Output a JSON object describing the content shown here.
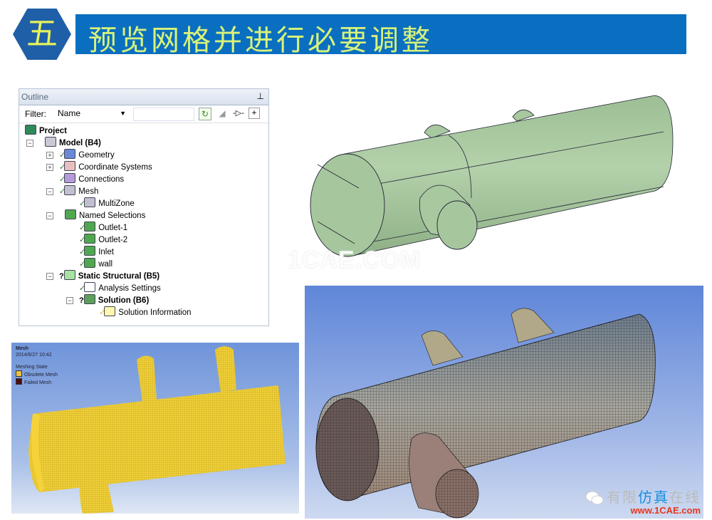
{
  "slide": {
    "number_glyph": "五",
    "title": "预览网格并进行必要调整",
    "colors": {
      "hex": "#1f5fa8",
      "banner": "#0a6fc0",
      "title_text": "#d8f27a"
    }
  },
  "outline": {
    "title": "Outline",
    "pin_glyph": "ꟼ",
    "filter_label": "Filter:",
    "filter_value": "Name",
    "search_value": "",
    "toolbar": {
      "refresh_glyph": "↻",
      "eraser_glyph": "◢",
      "plug_glyph": "-▷-",
      "expand_glyph": "+"
    },
    "tree": [
      {
        "label": "Project",
        "bold": true,
        "icon": "project-icon"
      },
      {
        "label": "Model (B4)",
        "bold": true,
        "icon": "model-icon",
        "expanded": true
      },
      {
        "label": "Geometry",
        "icon": "geometry-icon",
        "checked": true,
        "expandable": true
      },
      {
        "label": "Coordinate Systems",
        "icon": "coordinate-systems-icon",
        "checked": true,
        "expandable": true
      },
      {
        "label": "Connections",
        "icon": "connections-icon",
        "checked": true
      },
      {
        "label": "Mesh",
        "icon": "mesh-icon",
        "checked": true,
        "expanded": true
      },
      {
        "label": "MultiZone",
        "icon": "multizone-icon",
        "checked": true
      },
      {
        "label": "Named Selections",
        "icon": "named-selections-icon",
        "expanded": true
      },
      {
        "label": "Outlet-1",
        "icon": "named-selection-icon",
        "checked": true
      },
      {
        "label": "Outlet-2",
        "icon": "named-selection-icon",
        "checked": true
      },
      {
        "label": "Inlet",
        "icon": "named-selection-icon",
        "checked": true
      },
      {
        "label": "wall",
        "icon": "named-selection-icon",
        "checked": true
      },
      {
        "label": "Static Structural (B5)",
        "bold": true,
        "icon": "static-structural-icon",
        "status": "?",
        "expanded": true
      },
      {
        "label": "Analysis Settings",
        "icon": "analysis-settings-icon",
        "checked": true
      },
      {
        "label": "Solution (B6)",
        "bold": true,
        "icon": "solution-icon",
        "status": "?",
        "expanded": true
      },
      {
        "label": "Solution Information",
        "icon": "solution-information-icon",
        "checked": true
      }
    ]
  },
  "geometry_view": {
    "watermark": "1CAE.COM",
    "body_color": "#a8c8a0"
  },
  "yellow_mesh_view": {
    "title": "Mesh",
    "timestamp": "2014/6/27 10:42",
    "legend_title": "Meshing State",
    "legend": [
      {
        "label": "Obsolete Mesh",
        "color": "#f0c040"
      },
      {
        "label": "Failed Mesh",
        "color": "#4a0e0e"
      }
    ],
    "mesh_color": "#f2d23a"
  },
  "final_mesh_view": {
    "brand_cn_a": "有限",
    "brand_cn_b": "仿真",
    "brand_cn_c": "在线",
    "brand_url": "www.1CAE.com"
  }
}
